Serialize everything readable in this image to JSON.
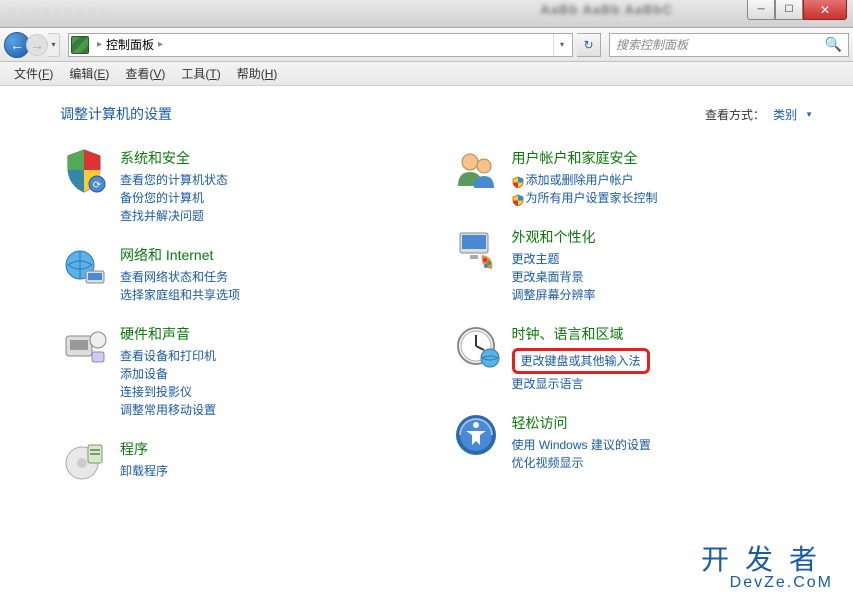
{
  "titlebar": {
    "blur1": "· · · · · · · · ·",
    "blur2": "AaBb AaBb AaBbC"
  },
  "nav": {
    "location": "控制面板",
    "search_placeholder": "搜索控制面板"
  },
  "menubar": {
    "items": [
      {
        "label": "文件",
        "key": "F"
      },
      {
        "label": "编辑",
        "key": "E"
      },
      {
        "label": "查看",
        "key": "V"
      },
      {
        "label": "工具",
        "key": "T"
      },
      {
        "label": "帮助",
        "key": "H"
      }
    ]
  },
  "header": {
    "title": "调整计算机的设置",
    "view_label": "查看方式：",
    "view_value": "类别"
  },
  "left_col": [
    {
      "title": "系统和安全",
      "links": [
        "查看您的计算机状态",
        "备份您的计算机",
        "查找并解决问题"
      ]
    },
    {
      "title": "网络和 Internet",
      "links": [
        "查看网络状态和任务",
        "选择家庭组和共享选项"
      ]
    },
    {
      "title": "硬件和声音",
      "links": [
        "查看设备和打印机",
        "添加设备",
        "连接到投影仪",
        "调整常用移动设置"
      ]
    },
    {
      "title": "程序",
      "links": [
        "卸载程序"
      ]
    }
  ],
  "right_col": [
    {
      "title": "用户帐户和家庭安全",
      "links": [
        {
          "text": "添加或删除用户帐户",
          "shield": true
        },
        {
          "text": "为所有用户设置家长控制",
          "shield": true
        }
      ]
    },
    {
      "title": "外观和个性化",
      "links": [
        "更改主题",
        "更改桌面背景",
        "调整屏幕分辨率"
      ]
    },
    {
      "title": "时钟、语言和区域",
      "links": [
        {
          "text": "更改键盘或其他输入法",
          "highlight": true
        },
        {
          "text": "更改显示语言"
        }
      ]
    },
    {
      "title": "轻松访问",
      "links": [
        "使用 Windows 建议的设置",
        "优化视频显示"
      ]
    }
  ],
  "watermark": {
    "cn": "开发者",
    "en": "DevZe.CoM"
  }
}
